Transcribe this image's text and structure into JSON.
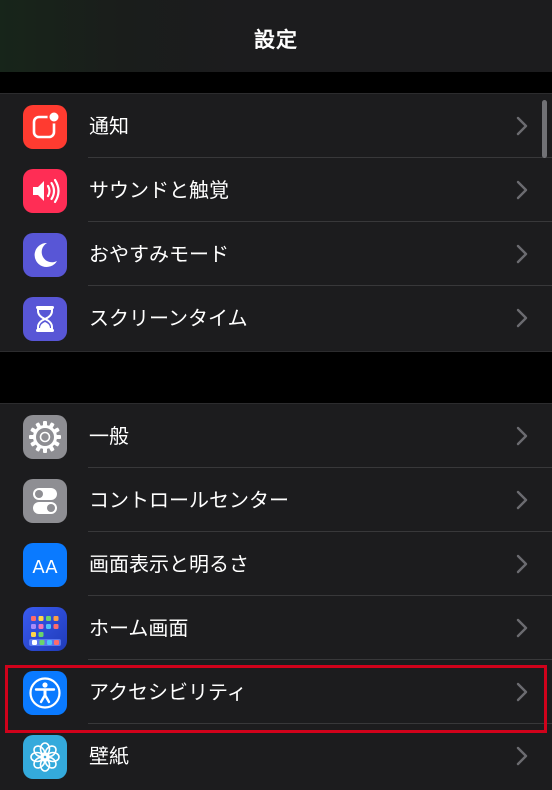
{
  "header": {
    "title": "設定"
  },
  "groups": [
    {
      "items": [
        {
          "label": "通知",
          "icon": "notifications-icon",
          "color": "#ff3b30"
        },
        {
          "label": "サウンドと触覚",
          "icon": "sound-icon",
          "color": "#ff2d55"
        },
        {
          "label": "おやすみモード",
          "icon": "moon-icon",
          "color": "#5856d6"
        },
        {
          "label": "スクリーンタイム",
          "icon": "hourglass-icon",
          "color": "#5856d6"
        }
      ]
    },
    {
      "items": [
        {
          "label": "一般",
          "icon": "gear-icon",
          "color": "#8e8e93"
        },
        {
          "label": "コントロールセンター",
          "icon": "toggle-icon",
          "color": "#8e8e93"
        },
        {
          "label": "画面表示と明るさ",
          "icon": "text-size-icon",
          "color": "#0a7aff",
          "glyph": "AA"
        },
        {
          "label": "ホーム画面",
          "icon": "home-screen-icon",
          "color": "#2c4dd8"
        },
        {
          "label": "アクセシビリティ",
          "icon": "accessibility-icon",
          "color": "#0a7aff",
          "highlighted": true
        },
        {
          "label": "壁紙",
          "icon": "flower-icon",
          "color": "#34aadc"
        }
      ]
    }
  ],
  "highlight_color": "#d0021b"
}
